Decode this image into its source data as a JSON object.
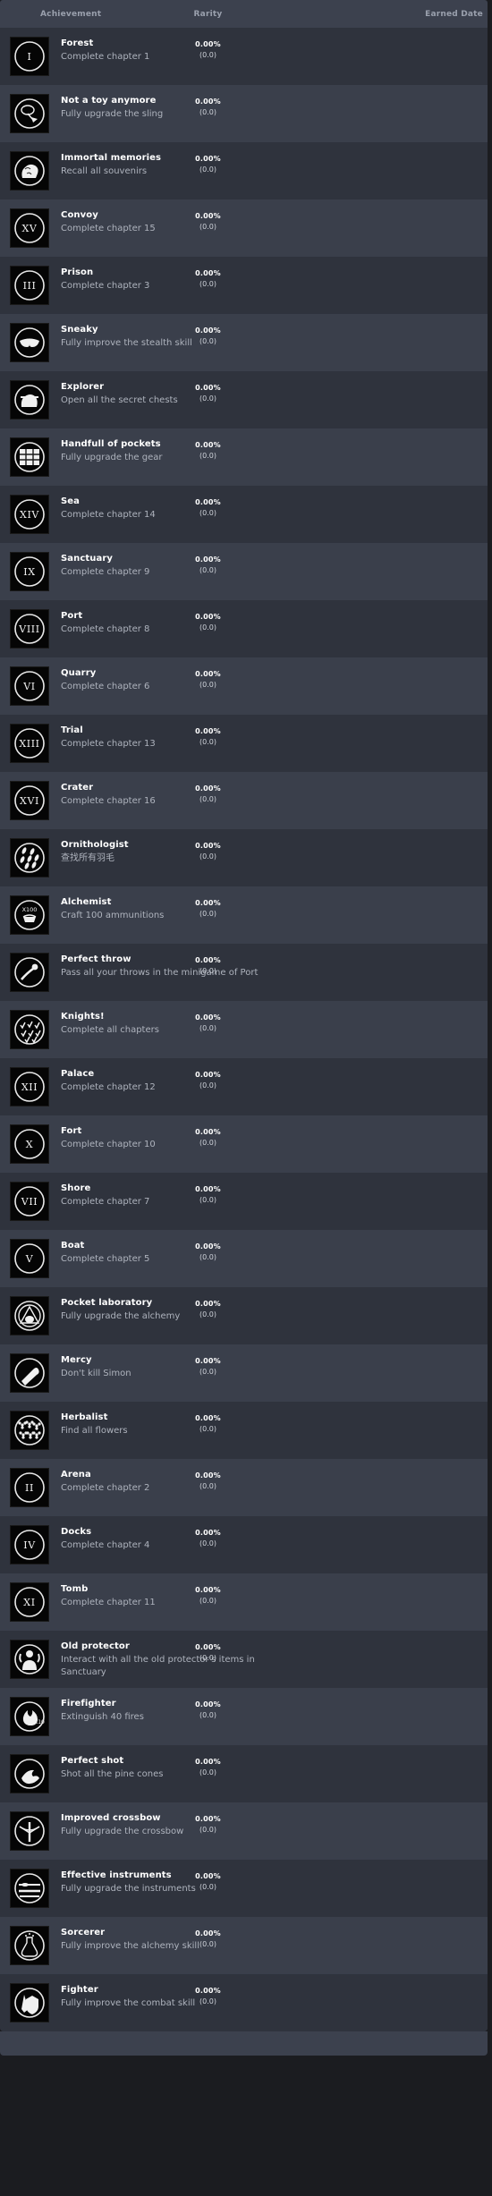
{
  "header": {
    "col_achievement": "Achievement",
    "col_rarity": "Rarity",
    "col_earned": "Earned Date"
  },
  "colors": {
    "page_bg": "#1b1c20",
    "header_bg": "#3c414e",
    "row_odd": "#2f333d",
    "row_even": "#3a3f4b",
    "title_text": "#ffffff",
    "desc_text": "#aeb3bd",
    "header_text": "#9aa0ad",
    "icon_bg": "#050505"
  },
  "achievements": [
    {
      "name": "Forest",
      "desc": "Complete chapter 1",
      "rarity": "0.00%",
      "count": "(0.0)",
      "earned": "",
      "icon": "roman-numeral-i-icon",
      "roman": "I"
    },
    {
      "name": "Not a toy anymore",
      "desc": "Fully upgrade the sling",
      "rarity": "0.00%",
      "count": "(0.0)",
      "earned": "",
      "icon": "sling-icon",
      "roman": ""
    },
    {
      "name": "Immortal memories",
      "desc": "Recall all souvenirs",
      "rarity": "0.00%",
      "count": "(0.0)",
      "earned": "",
      "icon": "head-brain-icon",
      "roman": ""
    },
    {
      "name": "Convoy",
      "desc": "Complete chapter 15",
      "rarity": "0.00%",
      "count": "(0.0)",
      "earned": "",
      "icon": "roman-numeral-xv-icon",
      "roman": "XV"
    },
    {
      "name": "Prison",
      "desc": "Complete chapter 3",
      "rarity": "0.00%",
      "count": "(0.0)",
      "earned": "",
      "icon": "roman-numeral-iii-icon",
      "roman": "III"
    },
    {
      "name": "Sneaky",
      "desc": "Fully improve the stealth skill",
      "rarity": "0.00%",
      "count": "(0.0)",
      "earned": "",
      "icon": "mask-icon",
      "roman": ""
    },
    {
      "name": "Explorer",
      "desc": "Open all the secret chests",
      "rarity": "0.00%",
      "count": "(0.0)",
      "earned": "",
      "icon": "explorer-head-icon",
      "roman": ""
    },
    {
      "name": "Handfull of pockets",
      "desc": "Fully upgrade the gear",
      "rarity": "0.00%",
      "count": "(0.0)",
      "earned": "",
      "icon": "pockets-grid-icon",
      "roman": ""
    },
    {
      "name": "Sea",
      "desc": "Complete chapter 14",
      "rarity": "0.00%",
      "count": "(0.0)",
      "earned": "",
      "icon": "roman-numeral-xiv-icon",
      "roman": "XIV"
    },
    {
      "name": "Sanctuary",
      "desc": "Complete chapter 9",
      "rarity": "0.00%",
      "count": "(0.0)",
      "earned": "",
      "icon": "roman-numeral-ix-icon",
      "roman": "IX"
    },
    {
      "name": "Port",
      "desc": "Complete chapter 8",
      "rarity": "0.00%",
      "count": "(0.0)",
      "earned": "",
      "icon": "roman-numeral-viii-icon",
      "roman": "VIII"
    },
    {
      "name": "Quarry",
      "desc": "Complete chapter 6",
      "rarity": "0.00%",
      "count": "(0.0)",
      "earned": "",
      "icon": "roman-numeral-vi-icon",
      "roman": "VI"
    },
    {
      "name": "Trial",
      "desc": "Complete chapter 13",
      "rarity": "0.00%",
      "count": "(0.0)",
      "earned": "",
      "icon": "roman-numeral-xiii-icon",
      "roman": "XIII"
    },
    {
      "name": "Crater",
      "desc": "Complete chapter 16",
      "rarity": "0.00%",
      "count": "(0.0)",
      "earned": "",
      "icon": "roman-numeral-xvi-icon",
      "roman": "XVI"
    },
    {
      "name": "Ornithologist",
      "desc": "查找所有羽毛",
      "rarity": "0.00%",
      "count": "(0.0)",
      "earned": "",
      "icon": "feathers-icon",
      "roman": ""
    },
    {
      "name": "Alchemist",
      "desc": "Craft 100 ammunitions",
      "rarity": "0.00%",
      "count": "(0.0)",
      "earned": "",
      "icon": "alchemist-x100-icon",
      "roman": ""
    },
    {
      "name": "Perfect throw",
      "desc": "Pass all your throws in the minigame of Port",
      "rarity": "0.00%",
      "count": "(0.0)",
      "earned": "",
      "icon": "throwing-arm-icon",
      "roman": ""
    },
    {
      "name": "Knights!",
      "desc": "Complete all chapters",
      "rarity": "0.00%",
      "count": "(0.0)",
      "earned": "",
      "icon": "checkmarks-icon",
      "roman": ""
    },
    {
      "name": "Palace",
      "desc": "Complete chapter 12",
      "rarity": "0.00%",
      "count": "(0.0)",
      "earned": "",
      "icon": "roman-numeral-xii-icon",
      "roman": "XII"
    },
    {
      "name": "Fort",
      "desc": "Complete chapter 10",
      "rarity": "0.00%",
      "count": "(0.0)",
      "earned": "",
      "icon": "roman-numeral-x-icon",
      "roman": "X"
    },
    {
      "name": "Shore",
      "desc": "Complete chapter 7",
      "rarity": "0.00%",
      "count": "(0.0)",
      "earned": "",
      "icon": "roman-numeral-vii-icon",
      "roman": "VII"
    },
    {
      "name": "Boat",
      "desc": "Complete chapter 5",
      "rarity": "0.00%",
      "count": "(0.0)",
      "earned": "",
      "icon": "roman-numeral-v-icon",
      "roman": "V"
    },
    {
      "name": "Pocket laboratory",
      "desc": "Fully upgrade the alchemy",
      "rarity": "0.00%",
      "count": "(0.0)",
      "earned": "",
      "icon": "alchemy-triangle-icon",
      "roman": ""
    },
    {
      "name": "Mercy",
      "desc": "Don't kill Simon",
      "rarity": "0.00%",
      "count": "(0.0)",
      "earned": "",
      "icon": "club-weapon-icon",
      "roman": ""
    },
    {
      "name": "Herbalist",
      "desc": "Find all flowers",
      "rarity": "0.00%",
      "count": "(0.0)",
      "earned": "",
      "icon": "flowers-icon",
      "roman": ""
    },
    {
      "name": "Arena",
      "desc": "Complete chapter 2",
      "rarity": "0.00%",
      "count": "(0.0)",
      "earned": "",
      "icon": "roman-numeral-ii-icon",
      "roman": "II"
    },
    {
      "name": "Docks",
      "desc": "Complete chapter 4",
      "rarity": "0.00%",
      "count": "(0.0)",
      "earned": "",
      "icon": "roman-numeral-iv-icon",
      "roman": "IV"
    },
    {
      "name": "Tomb",
      "desc": "Complete chapter 11",
      "rarity": "0.00%",
      "count": "(0.0)",
      "earned": "",
      "icon": "roman-numeral-xi-icon",
      "roman": "XI"
    },
    {
      "name": "Old protector",
      "desc": "Interact with all the old protector's items in Sanctuary",
      "rarity": "0.00%",
      "count": "(0.0)",
      "earned": "",
      "icon": "protector-figure-icon",
      "roman": ""
    },
    {
      "name": "Firefighter",
      "desc": "Extinguish 40 fires",
      "rarity": "0.00%",
      "count": "(0.0)",
      "earned": "",
      "icon": "fire-x10-icon",
      "roman": ""
    },
    {
      "name": "Perfect shot",
      "desc": "Shot all the pine cones",
      "rarity": "0.00%",
      "count": "(0.0)",
      "earned": "",
      "icon": "pine-cone-icon",
      "roman": ""
    },
    {
      "name": "Improved crossbow",
      "desc": "Fully upgrade the crossbow",
      "rarity": "0.00%",
      "count": "(0.0)",
      "earned": "",
      "icon": "crossbow-icon",
      "roman": ""
    },
    {
      "name": "Effective instruments",
      "desc": "Fully upgrade the instruments",
      "rarity": "0.00%",
      "count": "(0.0)",
      "earned": "",
      "icon": "instruments-icon",
      "roman": ""
    },
    {
      "name": "Sorcerer",
      "desc": "Fully improve the alchemy skill",
      "rarity": "0.00%",
      "count": "(0.0)",
      "earned": "",
      "icon": "potion-flask-icon",
      "roman": ""
    },
    {
      "name": "Fighter",
      "desc": "Fully improve the combat skill",
      "rarity": "0.00%",
      "count": "(0.0)",
      "earned": "",
      "icon": "sword-shield-icon",
      "roman": ""
    }
  ]
}
